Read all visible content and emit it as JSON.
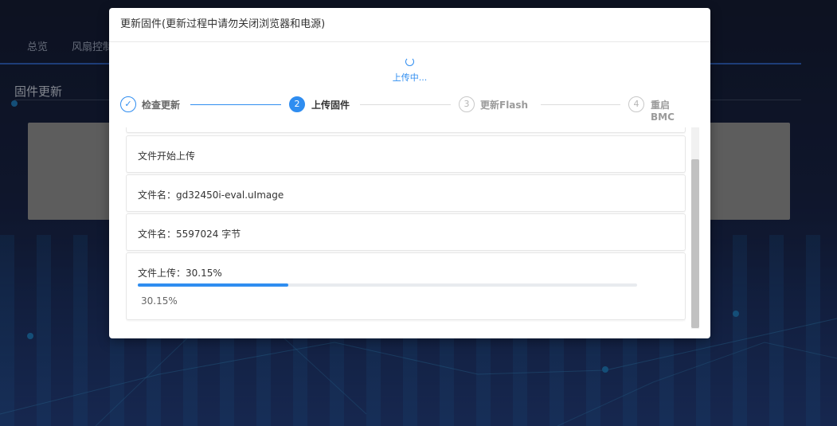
{
  "background": {
    "nav_items": [
      "总览",
      "风扇控制"
    ],
    "page_title": "固件更新"
  },
  "modal": {
    "title": "更新固件(更新过程中请勿关闭浏览器和电源)",
    "status_text": "上传中...",
    "steps": [
      {
        "number": "✓",
        "label": "检查更新",
        "state": "done"
      },
      {
        "number": "2",
        "label": "上传固件",
        "state": "active"
      },
      {
        "number": "3",
        "label": "更新Flash",
        "state": "todo"
      },
      {
        "number": "4",
        "label": "重启BMC",
        "state": "todo"
      }
    ],
    "logs": [
      "文件开始上传",
      "文件名：gd32450i-eval.uImage",
      "文件名：5597024 字节",
      "文件上传：30.15%"
    ],
    "upload_progress": {
      "percent": 30.15,
      "label": "30.15%"
    }
  },
  "colors": {
    "accent": "#2f8df0",
    "gray_card": "#8f8f8f"
  }
}
